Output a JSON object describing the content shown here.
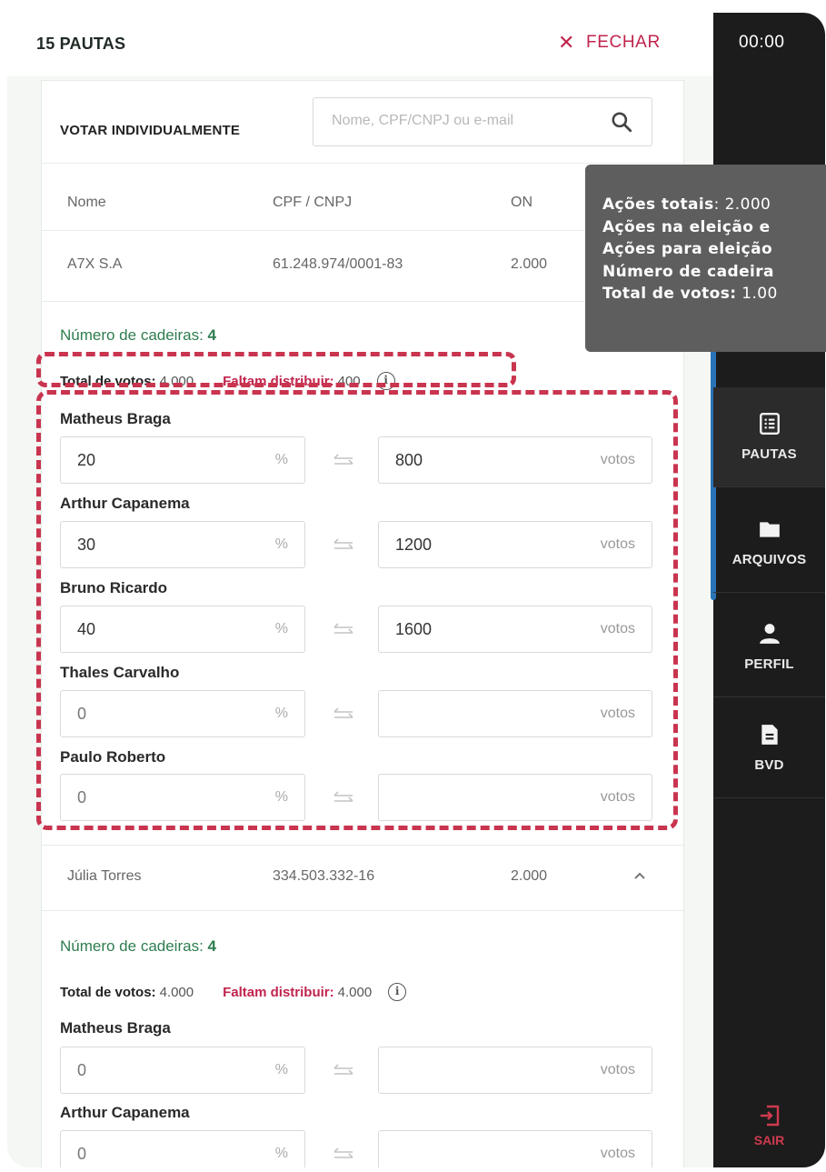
{
  "header": {
    "title": "15 PAUTAS",
    "close_label": "FECHAR",
    "timer": "00:00"
  },
  "vote_individually": {
    "label": "VOTAR INDIVIDUALMENTE",
    "search_placeholder": "Nome, CPF/CNPJ ou e-mail"
  },
  "table": {
    "columns": [
      "Nome",
      "CPF / CNPJ",
      "ON"
    ],
    "rows": [
      {
        "name": "A7X S.A",
        "doc": "61.248.974/0001-83",
        "on": "2.000"
      },
      {
        "name": "Júlia Torres",
        "doc": "334.503.332-16",
        "on": "2.000"
      }
    ]
  },
  "section1": {
    "seats_label": "Número de cadeiras:",
    "seats_value": "4",
    "total_label": "Total de votos:",
    "total_value": "4.000",
    "remaining_label": "Faltam distribuir:",
    "remaining_value": "400",
    "candidates": [
      {
        "name": "Matheus Braga",
        "pct": "20",
        "votes": "800"
      },
      {
        "name": "Arthur Capanema",
        "pct": "30",
        "votes": "1200"
      },
      {
        "name": "Bruno Ricardo",
        "pct": "40",
        "votes": "1600"
      },
      {
        "name": "Thales Carvalho",
        "pct": "0",
        "votes": ""
      },
      {
        "name": "Paulo Roberto",
        "pct": "0",
        "votes": ""
      }
    ]
  },
  "section2": {
    "seats_label": "Número de cadeiras:",
    "seats_value": "4",
    "total_label": "Total de votos:",
    "total_value": "4.000",
    "remaining_label": "Faltam distribuir:",
    "remaining_value": "4.000",
    "candidates": [
      {
        "name": "Matheus Braga",
        "pct": "0",
        "votes": ""
      },
      {
        "name": "Arthur Capanema",
        "pct": "0",
        "votes": ""
      }
    ]
  },
  "units": {
    "pct": "%",
    "votes": "votos"
  },
  "tooltip": {
    "lines": [
      {
        "label": "Ações totais",
        "sep": ":",
        "value": " 2.000"
      },
      {
        "label": "Ações na eleição e",
        "sep": "",
        "value": ""
      },
      {
        "label": "Ações para eleição",
        "sep": "",
        "value": ""
      },
      {
        "label": "Número de cadeira",
        "sep": "",
        "value": ""
      },
      {
        "label": "Total de votos:",
        "sep": "",
        "value": " 1.00"
      }
    ]
  },
  "sidebar": {
    "items": [
      {
        "label": "PAUTAS",
        "icon": "list-icon"
      },
      {
        "label": "ARQUIVOS",
        "icon": "folder-icon"
      },
      {
        "label": "PERFIL",
        "icon": "user-icon"
      },
      {
        "label": "BVD",
        "icon": "document-icon"
      }
    ],
    "logout_label": "SAIR"
  },
  "colors": {
    "accent_red": "#c0244d",
    "green": "#2e7d4f",
    "sidebar": "#1c1c1c",
    "scroll": "#2a73b8"
  }
}
